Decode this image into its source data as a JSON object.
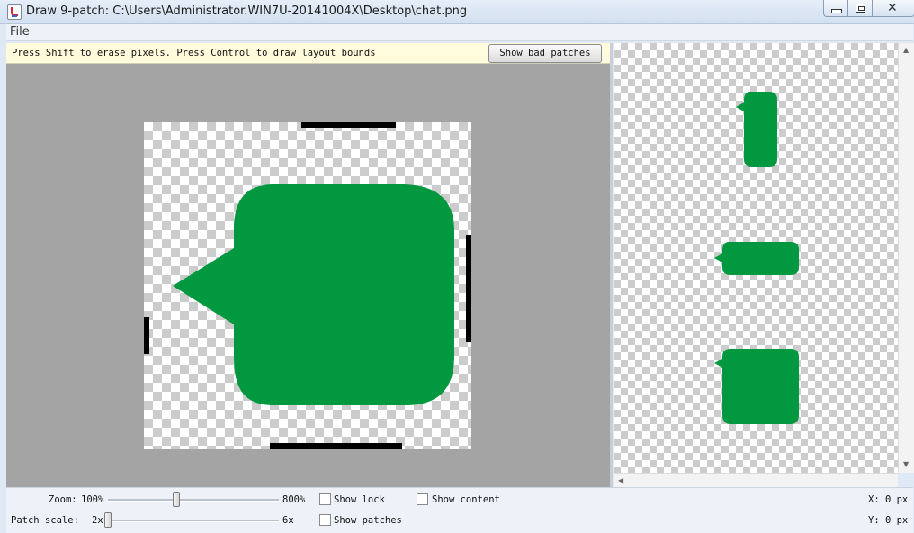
{
  "window": {
    "title": "Draw 9-patch: C:\\Users\\Administrator.WIN7U-20141004X\\Desktop\\chat.png"
  },
  "menu": {
    "file": "File"
  },
  "editor": {
    "hint": "Press Shift to erase pixels. Press Control to draw layout bounds",
    "bad_patches_button": "Show bad patches",
    "bubble_color": "#029840"
  },
  "controls": {
    "zoom_label": "Zoom:",
    "zoom_min": "100%",
    "zoom_max": "800%",
    "patch_scale_label": "Patch scale:",
    "patch_scale_min": "2x",
    "patch_scale_max": "6x",
    "show_lock": "Show lock",
    "show_content": "Show content",
    "show_patches": "Show patches",
    "x_readout": "X: 0 px",
    "y_readout": "Y: 0 px"
  },
  "icons": [
    "java-app-icon",
    "minimize-icon",
    "maximize-icon",
    "close-icon",
    "scroll-up-icon",
    "scroll-down-icon",
    "scroll-left-icon"
  ]
}
